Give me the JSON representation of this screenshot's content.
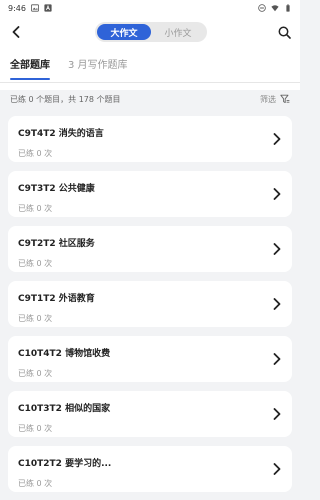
{
  "status_bar": {
    "time": "9:46"
  },
  "header": {
    "segments": [
      {
        "label": "大作文",
        "active": true
      },
      {
        "label": "小作文",
        "active": false
      }
    ],
    "tabs": [
      {
        "label": "全部题库",
        "active": true
      },
      {
        "label": "3 月写作题库",
        "active": false
      }
    ]
  },
  "summary": {
    "text": "已练 0 个题目，共 178 个题目",
    "filter_label": "筛选"
  },
  "items": [
    {
      "title": "C9T4T2 消失的语言",
      "sub": "已练 0 次"
    },
    {
      "title": "C9T3T2 公共健康",
      "sub": "已练 0 次"
    },
    {
      "title": "C9T2T2 社区服务",
      "sub": "已练 0 次"
    },
    {
      "title": "C9T1T2 外语教育",
      "sub": "已练 0 次"
    },
    {
      "title": "C10T4T2 博物馆收费",
      "sub": "已练 0 次"
    },
    {
      "title": "C10T3T2 相似的国家",
      "sub": "已练 0 次"
    },
    {
      "title": "C10T2T2 要学习的...",
      "sub": "已练 0 次"
    }
  ],
  "colors": {
    "accent": "#2f63d8",
    "background": "#f2f3f5"
  }
}
